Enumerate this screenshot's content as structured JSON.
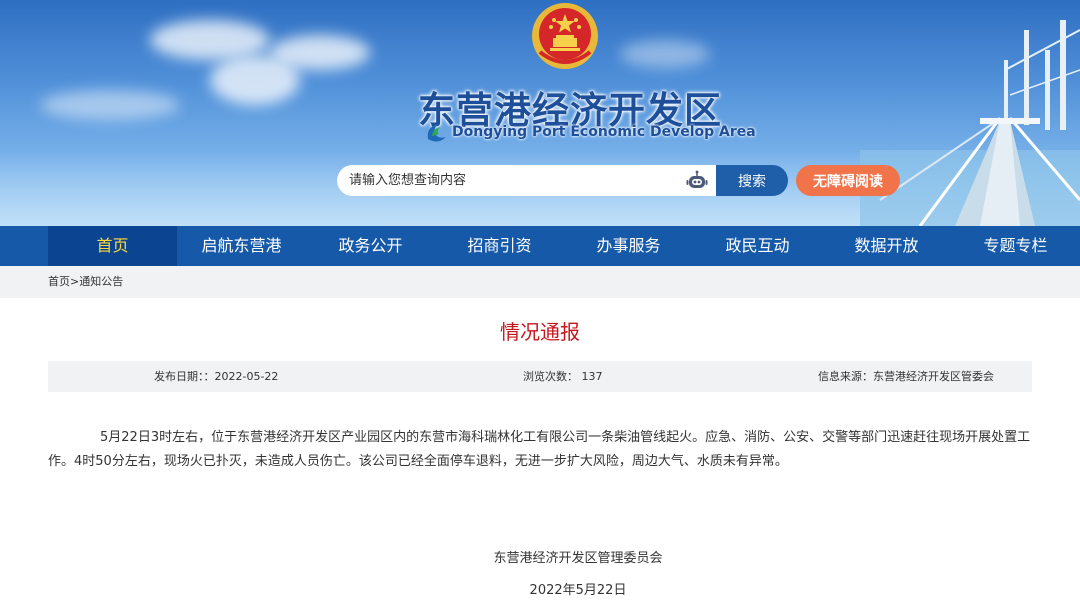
{
  "header": {
    "site_title": "东营港经济开发区",
    "site_subtitle": "Dongying Port Economic Develop Area",
    "search_placeholder": "请输入您想查询内容",
    "search_button": "搜索",
    "accessibility_button": "无障碍阅读"
  },
  "nav": {
    "items": [
      "首页",
      "启航东营港",
      "政务公开",
      "招商引资",
      "办事服务",
      "政民互动",
      "数据开放",
      "专题专栏"
    ],
    "active": "首页"
  },
  "breadcrumb": {
    "home": "首页",
    "separator": ">",
    "current": "通知公告"
  },
  "article": {
    "title": "情况通报",
    "meta": {
      "date": "发布日期：：2022-05-22",
      "views": "浏览次数：  137",
      "source": "信息来源：东营港经济开发区管委会"
    },
    "body": "5月22日3时左右，位于东营港经济开发区产业园区内的东营市海科瑞林化工有限公司一条柴油管线起火。应急、消防、公安、交警等部门迅速赶往现场开展处置工作。4时50分左右，现场火已扑灭，未造成人员伤亡。该公司已经全面停车退料，无进一步扩大风险，周边大气、水质未有异常。",
    "sign_org": "东营港经济开发区管理委员会",
    "sign_date": "2022年5月22日"
  },
  "colors": {
    "nav_bg": "#1559a8",
    "nav_active_bg": "#0b4592",
    "nav_active_text": "#ffd83a",
    "title_red": "#c8161d",
    "search_button_bg": "#1f5ea8",
    "access_button_bg": "#f0734a",
    "header_title": "#1e4f9a"
  },
  "icons": [
    "national-emblem-icon",
    "site-logo-icon",
    "robot-assistant-icon"
  ]
}
